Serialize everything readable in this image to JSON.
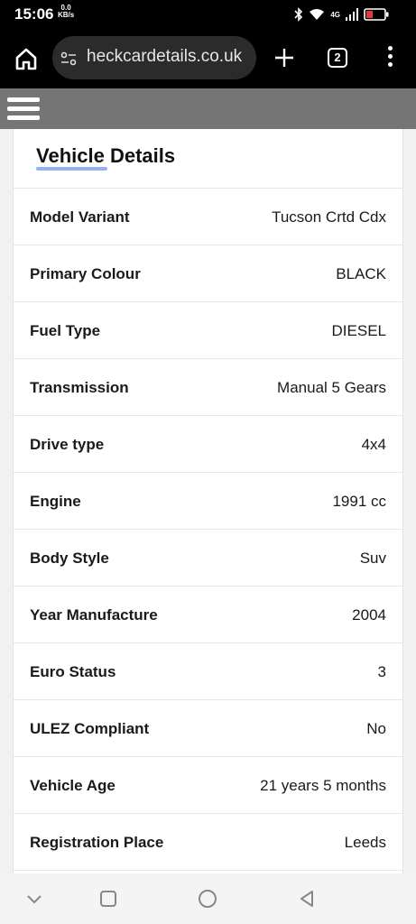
{
  "status_bar": {
    "time": "15:06",
    "speed_value": "0.0",
    "speed_unit": "KB/s",
    "network": "4G"
  },
  "browser": {
    "url": "heckcardetails.co.uk",
    "tab_count": "2"
  },
  "card": {
    "title": "Vehicle Details",
    "accent_color": "#8fb3f0",
    "rows": [
      {
        "label": "Model Variant",
        "value": "Tucson Crtd Cdx"
      },
      {
        "label": "Primary Colour",
        "value": "BLACK"
      },
      {
        "label": "Fuel Type",
        "value": "DIESEL"
      },
      {
        "label": "Transmission",
        "value": "Manual 5 Gears"
      },
      {
        "label": "Drive type",
        "value": "4x4"
      },
      {
        "label": "Engine",
        "value": "1991 cc"
      },
      {
        "label": "Body Style",
        "value": "Suv"
      },
      {
        "label": "Year Manufacture",
        "value": "2004"
      },
      {
        "label": "Euro Status",
        "value": "3"
      },
      {
        "label": "ULEZ Compliant",
        "value": "No"
      },
      {
        "label": "Vehicle Age",
        "value": "21 years 5 months"
      },
      {
        "label": "Registration Place",
        "value": "Leeds"
      }
    ]
  }
}
